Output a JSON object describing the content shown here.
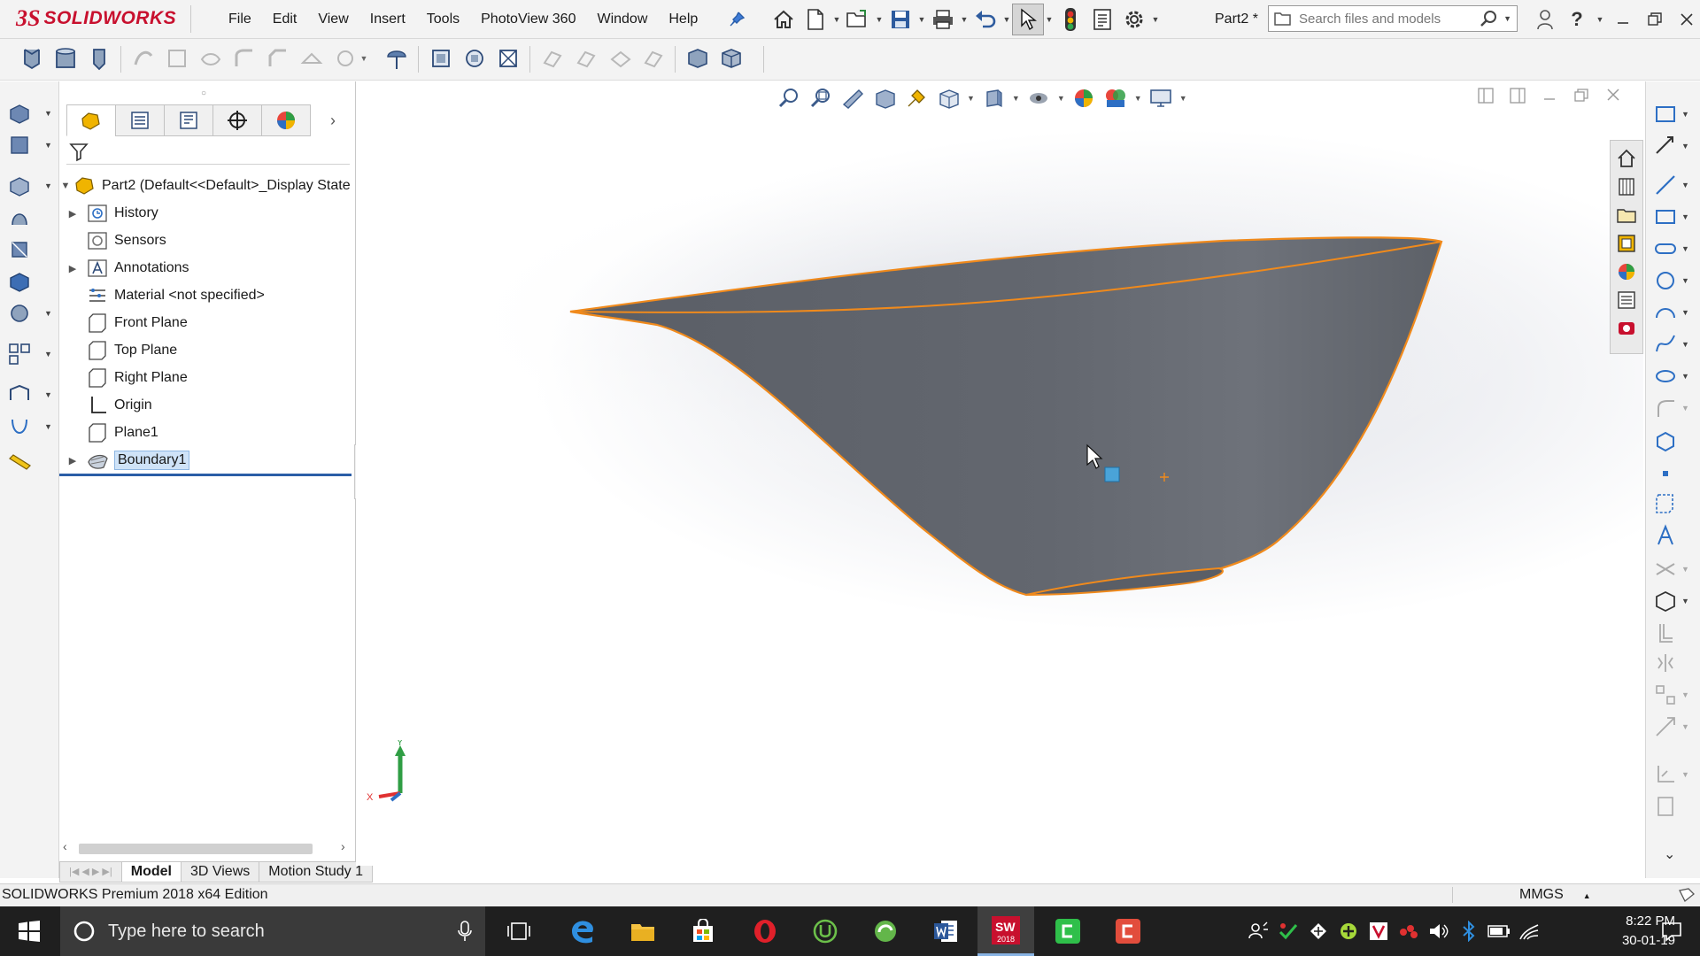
{
  "app": {
    "logo_text": "SOLIDWORKS",
    "logo_mark": "3S",
    "doc_title": "Part2 *"
  },
  "menu": [
    "File",
    "Edit",
    "View",
    "Insert",
    "Tools",
    "PhotoView 360",
    "Window",
    "Help"
  ],
  "search": {
    "placeholder": "Search files and models"
  },
  "feature_tree": {
    "root": "Part2  (Default<<Default>_Display State",
    "items": [
      {
        "label": "History",
        "icon": "history-icon",
        "expandable": true
      },
      {
        "label": "Sensors",
        "icon": "sensors-icon",
        "expandable": false
      },
      {
        "label": "Annotations",
        "icon": "annotations-icon",
        "expandable": true
      },
      {
        "label": "Material <not specified>",
        "icon": "material-icon",
        "expandable": false
      },
      {
        "label": "Front Plane",
        "icon": "plane-icon",
        "expandable": false
      },
      {
        "label": "Top Plane",
        "icon": "plane-icon",
        "expandable": false
      },
      {
        "label": "Right Plane",
        "icon": "plane-icon",
        "expandable": false
      },
      {
        "label": "Origin",
        "icon": "origin-icon",
        "expandable": false
      },
      {
        "label": "Plane1",
        "icon": "plane-icon",
        "expandable": false
      },
      {
        "label": "Boundary1",
        "icon": "boundary-surface-icon",
        "expandable": true,
        "selected": true
      }
    ]
  },
  "bottom_tabs": [
    "Model",
    "3D Views",
    "Motion Study 1"
  ],
  "triad": {
    "y": "Y",
    "x": "X"
  },
  "status": {
    "text": "SOLIDWORKS Premium 2018 x64 Edition",
    "units": "MMGS"
  },
  "taskbar": {
    "search_placeholder": "Type here to search",
    "time": "8:22 PM",
    "date": "30-01-19",
    "sw_badge": "2018"
  },
  "colors": {
    "brand_red": "#c8102e",
    "surface": "#5f636b",
    "edge_highlight": "#f08a1c",
    "selection": "#cfe3f8",
    "taskbar": "#1f1f1f"
  }
}
